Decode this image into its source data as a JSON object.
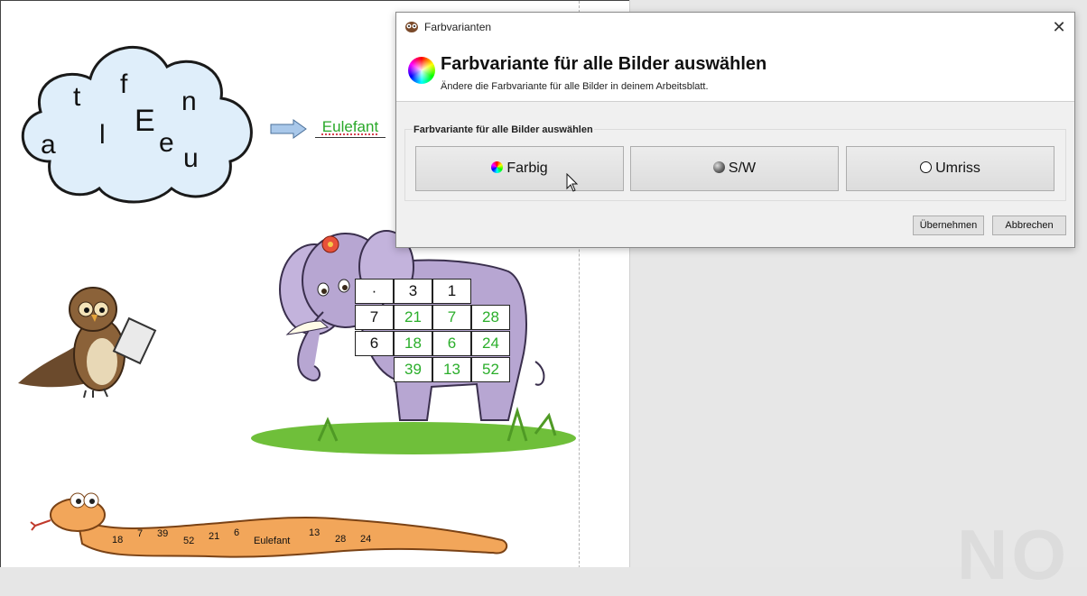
{
  "worksheet": {
    "cloud_letters": [
      "t",
      "f",
      "n",
      "E",
      "l",
      "a",
      "e",
      "u"
    ],
    "answer_word": "Eulefant",
    "grid": {
      "rows": [
        [
          "·",
          "3",
          "1",
          ""
        ],
        [
          "7",
          "21",
          "7",
          "28"
        ],
        [
          "6",
          "18",
          "6",
          "24"
        ],
        [
          "",
          "39",
          "13",
          "52"
        ]
      ]
    },
    "snake_numbers": [
      "18",
      "7",
      "39",
      "52",
      "21",
      "6",
      "Eulefant",
      "13",
      "28",
      "24"
    ]
  },
  "dialog": {
    "window_title": "Farbvarianten",
    "close_symbol": "✕",
    "heading": "Farbvariante für alle Bilder auswählen",
    "description": "Ändere die Farbvariante für alle Bilder in deinem Arbeitsblatt.",
    "group_label": "Farbvariante für alle Bilder auswählen",
    "options": [
      {
        "label": "Farbig",
        "icon": "color-wheel-icon"
      },
      {
        "label": "S/W",
        "icon": "grey-sphere-icon"
      },
      {
        "label": "Umriss",
        "icon": "outline-circle-icon"
      }
    ],
    "apply_label": "Übernehmen",
    "cancel_label": "Abbrechen"
  },
  "colors": {
    "answer_green": "#2aae2a",
    "cloud_fill": "#dfeefa",
    "elephant": "#b7a6d2"
  }
}
